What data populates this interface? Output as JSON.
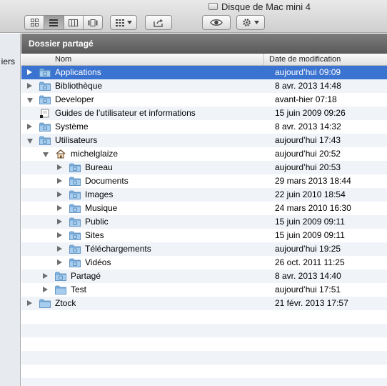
{
  "window": {
    "title": "Disque de Mac mini 4"
  },
  "sidebar": {
    "partial_label": "iers"
  },
  "path_bar": {
    "title": "Dossier partagé"
  },
  "columns": {
    "name": "Nom",
    "date": "Date de modification"
  },
  "rows": [
    {
      "name": "Applications",
      "date": "aujourd’hui 09:09",
      "level": 0,
      "disclosure": "right",
      "icon": "applications-folder-icon",
      "selected": true
    },
    {
      "name": "Bibliothèque",
      "date": "8 avr. 2013 14:48",
      "level": 0,
      "disclosure": "right",
      "icon": "library-folder-icon"
    },
    {
      "name": "Developer",
      "date": "avant-hier 07:18",
      "level": 0,
      "disclosure": "down",
      "icon": "developer-folder-icon"
    },
    {
      "name": "Guides de l’utilisateur et informations",
      "date": "15 juin 2009 09:26",
      "level": 0,
      "disclosure": "none",
      "icon": "alias-folder-icon"
    },
    {
      "name": "Système",
      "date": "8 avr. 2013 14:32",
      "level": 0,
      "disclosure": "right",
      "icon": "system-folder-icon"
    },
    {
      "name": "Utilisateurs",
      "date": "aujourd’hui 17:43",
      "level": 0,
      "disclosure": "down",
      "icon": "users-folder-icon"
    },
    {
      "name": "michelglaize",
      "date": "aujourd’hui 20:52",
      "level": 1,
      "disclosure": "down",
      "icon": "home-icon"
    },
    {
      "name": "Bureau",
      "date": "aujourd’hui 20:53",
      "level": 2,
      "disclosure": "right",
      "icon": "desktop-folder-icon"
    },
    {
      "name": "Documents",
      "date": "29 mars 2013 18:44",
      "level": 2,
      "disclosure": "right",
      "icon": "documents-folder-icon"
    },
    {
      "name": "Images",
      "date": "22 juin 2010 18:54",
      "level": 2,
      "disclosure": "right",
      "icon": "pictures-folder-icon"
    },
    {
      "name": "Musique",
      "date": "24 mars 2010 16:30",
      "level": 2,
      "disclosure": "right",
      "icon": "music-folder-icon"
    },
    {
      "name": "Public",
      "date": "15 juin 2009 09:11",
      "level": 2,
      "disclosure": "right",
      "icon": "public-folder-icon"
    },
    {
      "name": "Sites",
      "date": "15 juin 2009 09:11",
      "level": 2,
      "disclosure": "right",
      "icon": "sites-folder-icon"
    },
    {
      "name": "Téléchargements",
      "date": "aujourd’hui 19:25",
      "level": 2,
      "disclosure": "right",
      "icon": "downloads-folder-icon"
    },
    {
      "name": "Vidéos",
      "date": "26 oct. 2011 11:25",
      "level": 2,
      "disclosure": "right",
      "icon": "movies-folder-icon"
    },
    {
      "name": "Partagé",
      "date": "8 avr. 2013 14:40",
      "level": 1,
      "disclosure": "right",
      "icon": "shared-folder-icon"
    },
    {
      "name": "Test",
      "date": "aujourd’hui 17:51",
      "level": 1,
      "disclosure": "right",
      "icon": "folder-icon"
    },
    {
      "name": "Ztock",
      "date": "21 févr. 2013 17:57",
      "level": 0,
      "disclosure": "right",
      "icon": "folder-icon"
    }
  ],
  "colors": {
    "selection": "#3b73d0",
    "folder": "#7eb4e2",
    "stripe": "#f0f4f9",
    "header_bar": "#6b6b6b"
  }
}
